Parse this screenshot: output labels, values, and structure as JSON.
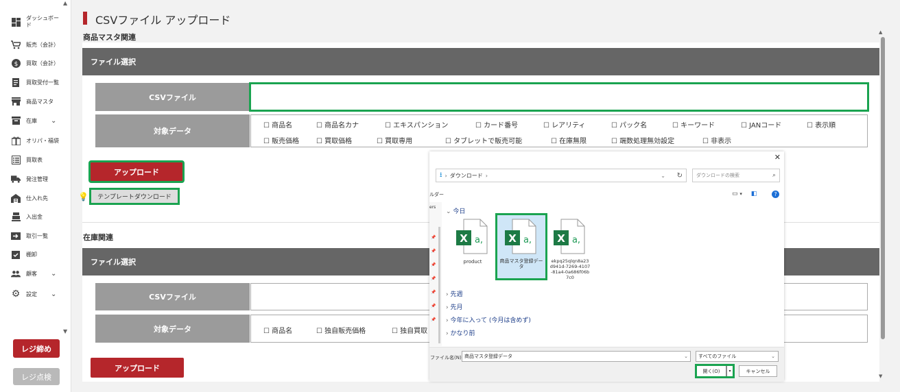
{
  "sidebar": {
    "items": [
      {
        "label": "ダッシュボー\nド",
        "icon": "dashboard-icon"
      },
      {
        "label": "販売（会計）",
        "icon": "cart-icon"
      },
      {
        "label": "買取（会計）",
        "icon": "dollar-icon"
      },
      {
        "label": "買取受付一覧",
        "icon": "document-icon"
      },
      {
        "label": "商品マスタ",
        "icon": "store-icon"
      },
      {
        "label": "在庫",
        "icon": "box-icon"
      },
      {
        "label": "オリパ・福袋",
        "icon": "gift-icon"
      },
      {
        "label": "買取表",
        "icon": "table-icon"
      },
      {
        "label": "発注管理",
        "icon": "truck-icon"
      },
      {
        "label": "仕入れ先",
        "icon": "warehouse-icon"
      },
      {
        "label": "入出金",
        "icon": "cash-register-icon"
      },
      {
        "label": "取引一覧",
        "icon": "transaction-icon"
      },
      {
        "label": "棚卸",
        "icon": "checklist-icon"
      },
      {
        "label": "顧客",
        "icon": "people-icon"
      },
      {
        "label": "設定",
        "icon": "gear-icon"
      }
    ],
    "close_register_label": "レジ締め",
    "register_check_label": "レジ点検"
  },
  "main": {
    "page_title": "CSVファイル アップロード",
    "product_section": {
      "label": "商品マスタ関連",
      "panel_title": "ファイル選択",
      "csv_label": "CSVファイル",
      "target_label": "対象データ",
      "checkboxes_row1": [
        "商品名",
        "商品名カナ",
        "エキスパンション",
        "カード番号",
        "レアリティ",
        "パック名",
        "キーワード",
        "JANコード",
        "表示順"
      ],
      "checkboxes_row2": [
        "販売価格",
        "買取価格",
        "買取専用",
        "タブレットで販売可能",
        "在庫無限",
        "端数処理無効設定",
        "非表示"
      ],
      "upload_label": "アップロード",
      "template_label": "テンプレートダウンロード"
    },
    "stock_section": {
      "label": "在庫関連",
      "panel_title": "ファイル選択",
      "csv_label": "CSVファイル",
      "target_label": "対象データ",
      "checkboxes": [
        "商品名",
        "独自販売価格",
        "独自買取"
      ],
      "upload_label": "アップロード"
    }
  },
  "dialog": {
    "close": "✕",
    "breadcrumb": "ダウンロード",
    "search_placeholder": "ダウンロードの検索",
    "folder_label": "ルダー",
    "nav_cut_label": "ers",
    "groups": {
      "today": "今日",
      "last_week": "先週",
      "last_month": "先月",
      "this_year": "今年に入って (今月は含めず)",
      "long_ago": "かなり前"
    },
    "files": [
      {
        "name": "product"
      },
      {
        "name": "商品マスタ登録デー\nタ"
      },
      {
        "name": "ekpq25qlqn8a23\nd941d-7269-4107\n-81a4-0a686f06b\n7c0"
      }
    ],
    "filename_label": "ファイル名(N):",
    "filename_value": "商品マスタ登録データ",
    "file_type": "すべてのファイル",
    "open_label": "開く(O)",
    "cancel_label": "キャンセル"
  },
  "colors": {
    "brand_red": "#b5262b",
    "highlight_green": "#1aa350",
    "panel_header": "#666666",
    "label_cell": "#9b9b9b"
  }
}
